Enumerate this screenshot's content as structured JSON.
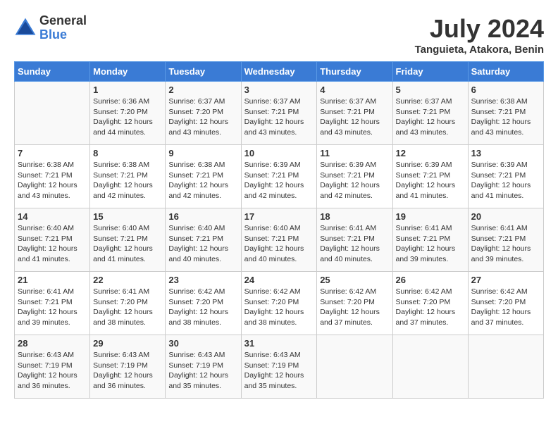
{
  "header": {
    "logo_general": "General",
    "logo_blue": "Blue",
    "month_title": "July 2024",
    "location": "Tanguieta, Atakora, Benin"
  },
  "days_of_week": [
    "Sunday",
    "Monday",
    "Tuesday",
    "Wednesday",
    "Thursday",
    "Friday",
    "Saturday"
  ],
  "weeks": [
    [
      {
        "day": "",
        "sunrise": "",
        "sunset": "",
        "daylight": ""
      },
      {
        "day": "1",
        "sunrise": "6:36 AM",
        "sunset": "7:20 PM",
        "daylight": "12 hours and 44 minutes."
      },
      {
        "day": "2",
        "sunrise": "6:37 AM",
        "sunset": "7:20 PM",
        "daylight": "12 hours and 43 minutes."
      },
      {
        "day": "3",
        "sunrise": "6:37 AM",
        "sunset": "7:21 PM",
        "daylight": "12 hours and 43 minutes."
      },
      {
        "day": "4",
        "sunrise": "6:37 AM",
        "sunset": "7:21 PM",
        "daylight": "12 hours and 43 minutes."
      },
      {
        "day": "5",
        "sunrise": "6:37 AM",
        "sunset": "7:21 PM",
        "daylight": "12 hours and 43 minutes."
      },
      {
        "day": "6",
        "sunrise": "6:38 AM",
        "sunset": "7:21 PM",
        "daylight": "12 hours and 43 minutes."
      }
    ],
    [
      {
        "day": "7",
        "sunrise": "6:38 AM",
        "sunset": "7:21 PM",
        "daylight": "12 hours and 43 minutes."
      },
      {
        "day": "8",
        "sunrise": "6:38 AM",
        "sunset": "7:21 PM",
        "daylight": "12 hours and 42 minutes."
      },
      {
        "day": "9",
        "sunrise": "6:38 AM",
        "sunset": "7:21 PM",
        "daylight": "12 hours and 42 minutes."
      },
      {
        "day": "10",
        "sunrise": "6:39 AM",
        "sunset": "7:21 PM",
        "daylight": "12 hours and 42 minutes."
      },
      {
        "day": "11",
        "sunrise": "6:39 AM",
        "sunset": "7:21 PM",
        "daylight": "12 hours and 42 minutes."
      },
      {
        "day": "12",
        "sunrise": "6:39 AM",
        "sunset": "7:21 PM",
        "daylight": "12 hours and 41 minutes."
      },
      {
        "day": "13",
        "sunrise": "6:39 AM",
        "sunset": "7:21 PM",
        "daylight": "12 hours and 41 minutes."
      }
    ],
    [
      {
        "day": "14",
        "sunrise": "6:40 AM",
        "sunset": "7:21 PM",
        "daylight": "12 hours and 41 minutes."
      },
      {
        "day": "15",
        "sunrise": "6:40 AM",
        "sunset": "7:21 PM",
        "daylight": "12 hours and 41 minutes."
      },
      {
        "day": "16",
        "sunrise": "6:40 AM",
        "sunset": "7:21 PM",
        "daylight": "12 hours and 40 minutes."
      },
      {
        "day": "17",
        "sunrise": "6:40 AM",
        "sunset": "7:21 PM",
        "daylight": "12 hours and 40 minutes."
      },
      {
        "day": "18",
        "sunrise": "6:41 AM",
        "sunset": "7:21 PM",
        "daylight": "12 hours and 40 minutes."
      },
      {
        "day": "19",
        "sunrise": "6:41 AM",
        "sunset": "7:21 PM",
        "daylight": "12 hours and 39 minutes."
      },
      {
        "day": "20",
        "sunrise": "6:41 AM",
        "sunset": "7:21 PM",
        "daylight": "12 hours and 39 minutes."
      }
    ],
    [
      {
        "day": "21",
        "sunrise": "6:41 AM",
        "sunset": "7:21 PM",
        "daylight": "12 hours and 39 minutes."
      },
      {
        "day": "22",
        "sunrise": "6:41 AM",
        "sunset": "7:20 PM",
        "daylight": "12 hours and 38 minutes."
      },
      {
        "day": "23",
        "sunrise": "6:42 AM",
        "sunset": "7:20 PM",
        "daylight": "12 hours and 38 minutes."
      },
      {
        "day": "24",
        "sunrise": "6:42 AM",
        "sunset": "7:20 PM",
        "daylight": "12 hours and 38 minutes."
      },
      {
        "day": "25",
        "sunrise": "6:42 AM",
        "sunset": "7:20 PM",
        "daylight": "12 hours and 37 minutes."
      },
      {
        "day": "26",
        "sunrise": "6:42 AM",
        "sunset": "7:20 PM",
        "daylight": "12 hours and 37 minutes."
      },
      {
        "day": "27",
        "sunrise": "6:42 AM",
        "sunset": "7:20 PM",
        "daylight": "12 hours and 37 minutes."
      }
    ],
    [
      {
        "day": "28",
        "sunrise": "6:43 AM",
        "sunset": "7:19 PM",
        "daylight": "12 hours and 36 minutes."
      },
      {
        "day": "29",
        "sunrise": "6:43 AM",
        "sunset": "7:19 PM",
        "daylight": "12 hours and 36 minutes."
      },
      {
        "day": "30",
        "sunrise": "6:43 AM",
        "sunset": "7:19 PM",
        "daylight": "12 hours and 35 minutes."
      },
      {
        "day": "31",
        "sunrise": "6:43 AM",
        "sunset": "7:19 PM",
        "daylight": "12 hours and 35 minutes."
      },
      {
        "day": "",
        "sunrise": "",
        "sunset": "",
        "daylight": ""
      },
      {
        "day": "",
        "sunrise": "",
        "sunset": "",
        "daylight": ""
      },
      {
        "day": "",
        "sunrise": "",
        "sunset": "",
        "daylight": ""
      }
    ]
  ],
  "labels": {
    "sunrise": "Sunrise:",
    "sunset": "Sunset:",
    "daylight": "Daylight:"
  }
}
